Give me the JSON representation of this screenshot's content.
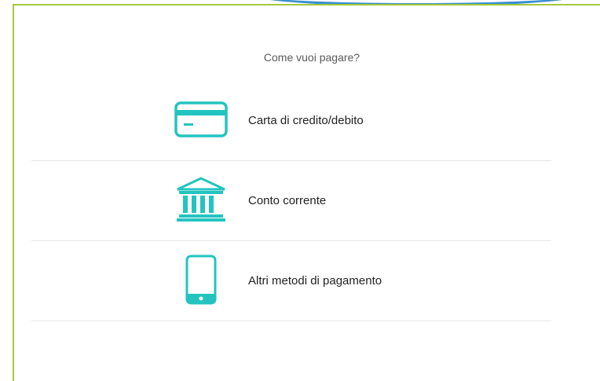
{
  "prompt": "Come vuoi pagare?",
  "options": [
    {
      "label": "Carta di credito/debito",
      "icon": "credit-card-icon"
    },
    {
      "label": "Conto corrente",
      "icon": "bank-icon"
    },
    {
      "label": "Altri metodi di pagamento",
      "icon": "smartphone-icon"
    }
  ],
  "colors": {
    "accent": "#23c4c0",
    "frame": "#a6c83a",
    "top_arc": "#3b8fd0",
    "divider": "#e6e6e6"
  }
}
